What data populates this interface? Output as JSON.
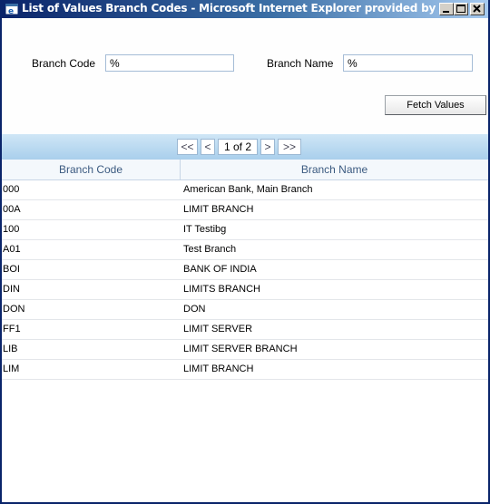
{
  "window": {
    "title": "List of Values Branch Codes - Microsoft Internet Explorer provided by i-..."
  },
  "search": {
    "branch_code_label": "Branch Code",
    "branch_code_value": "%",
    "branch_name_label": "Branch Name",
    "branch_name_value": "%",
    "fetch_label": "Fetch Values"
  },
  "pager": {
    "first": "<<",
    "prev": "<",
    "page": "1 of 2",
    "next": ">",
    "last": ">>"
  },
  "table": {
    "headers": [
      "Branch Code",
      "Branch Name"
    ],
    "rows": [
      [
        "000",
        "American Bank, Main Branch"
      ],
      [
        "00A",
        "LIMIT BRANCH"
      ],
      [
        "100",
        "IT Testibg"
      ],
      [
        "A01",
        "Test Branch"
      ],
      [
        "BOI",
        "BANK OF INDIA"
      ],
      [
        "DIN",
        "LIMITS BRANCH"
      ],
      [
        "DON",
        "DON"
      ],
      [
        "FF1",
        "LIMIT SERVER"
      ],
      [
        "LIB",
        "LIMIT SERVER BRANCH"
      ],
      [
        "LIM",
        "LIMIT BRANCH"
      ]
    ]
  },
  "colors": {
    "titlebar_start": "#0a246a",
    "titlebar_end": "#a6caf0",
    "pager_band": "#a9cfec",
    "header_text": "#3b5a80"
  }
}
